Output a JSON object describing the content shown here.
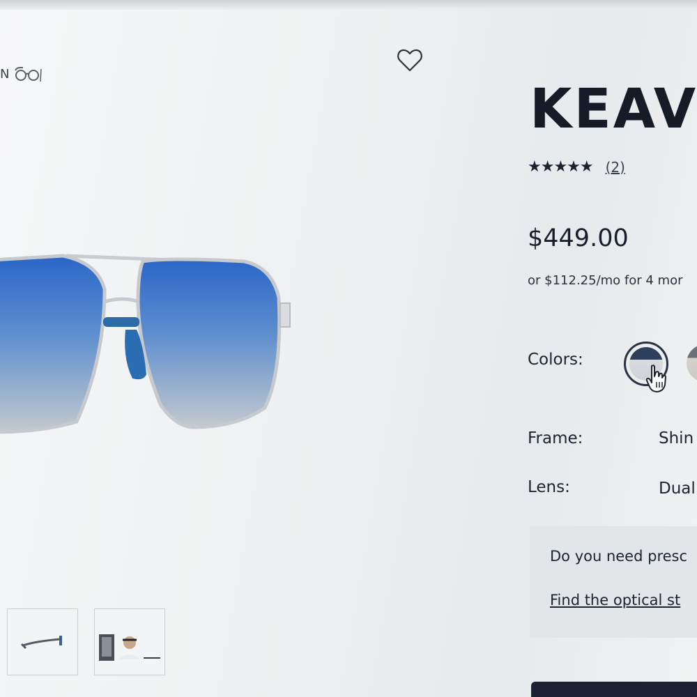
{
  "try_on": {
    "label": "N"
  },
  "product": {
    "title": "KEAV",
    "rating": {
      "stars": "★★★★★",
      "review_count": "(2)"
    },
    "price": "$449.00",
    "installments": "or $112.25/mo for 4 mor"
  },
  "options": {
    "colors_label": "Colors:",
    "frame_label": "Frame:",
    "frame_value": "Shin",
    "lens_label": "Lens:",
    "lens_value": "Dual"
  },
  "prescription": {
    "question": "Do you need presc",
    "link": "Find the optical st"
  },
  "colors": {
    "lens_blue": "#2f6fd0",
    "lens_grey": "#b7bec5",
    "frame_silver": "#c9ccd0",
    "accent_dark": "#1b2133"
  },
  "icons": {
    "wishlist": "heart-icon",
    "try_on": "glasses-icon",
    "pointer": "hand-cursor-icon"
  }
}
